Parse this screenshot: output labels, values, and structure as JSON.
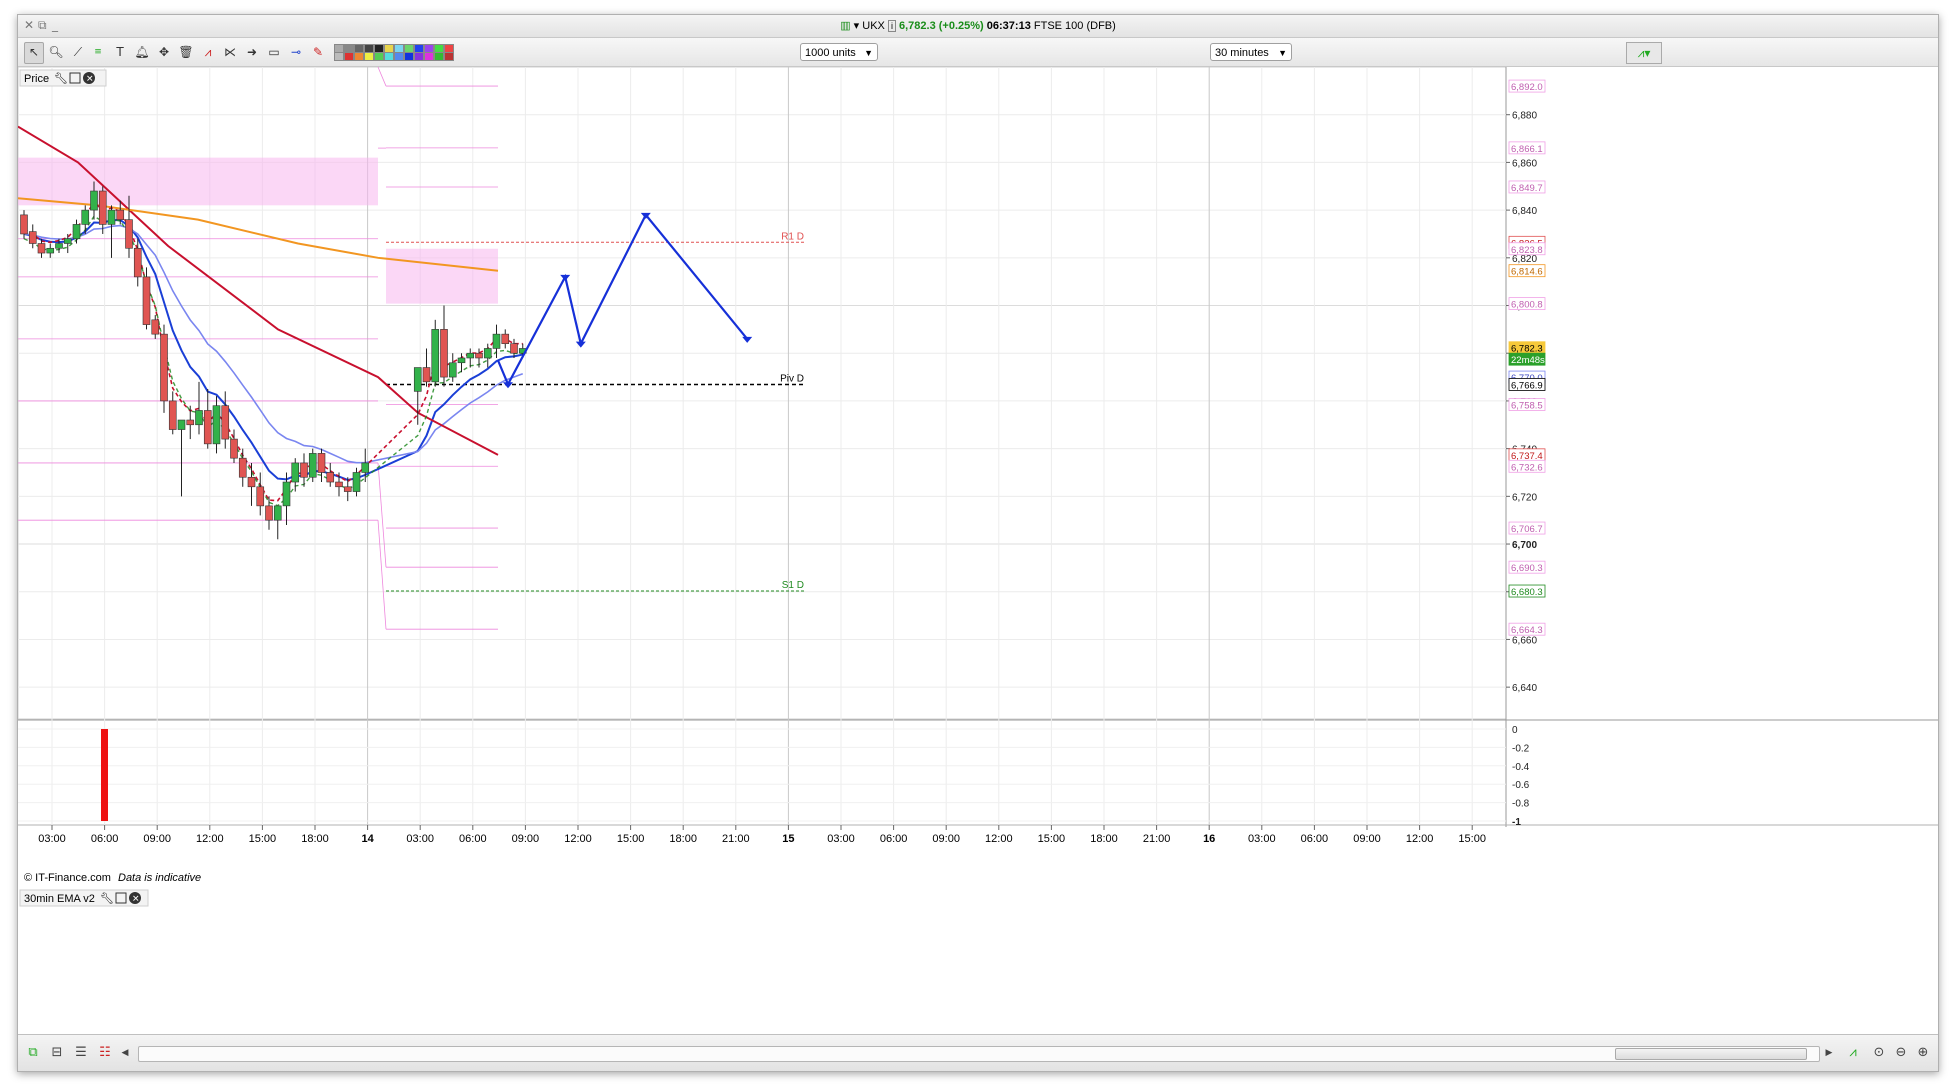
{
  "window": {
    "instrument": "UKX",
    "price": "6,782.3",
    "change": "(+0.25%)",
    "time": "06:37:13",
    "market": "FTSE 100 (DFB)"
  },
  "toolbar": {
    "units_value": "1000 units",
    "interval_value": "30 minutes",
    "tools": [
      "pointer-icon",
      "zoom-icon",
      "draw-line-icon",
      "fibonacci-icon",
      "text-tool-icon",
      "alert-bell-icon",
      "measure-icon",
      "trash-icon",
      "trend-line-icon",
      "fan-icon",
      "arrow-icon",
      "rectangle-icon",
      "horizontal-line-icon",
      "pencil-icon"
    ]
  },
  "panels": {
    "price_label": "Price",
    "indicator_label": "30min EMA v2",
    "copyright": "© IT-Finance.com",
    "disclaimer": "Data is indicative"
  },
  "colors": {
    "candle_up": "#32b24a",
    "candle_down": "#e05552",
    "ema_fast": "#1a3fd6",
    "ema_slow": "#7a86f0",
    "ema_long": "#c8102e",
    "ema_200": "#f29621",
    "signal_dashed": "#c8102e",
    "signal_dashed_green": "#1f8a1f",
    "zone": "#f7b6ee",
    "pivot_line": "#ee88dd",
    "projection": "#1630d8",
    "indicator_bar": "#ee1111"
  },
  "chart_data": {
    "type": "line",
    "ylim": [
      6630,
      6900
    ],
    "price_axis_labels": [
      "6,880",
      "6,860",
      "6,840",
      "6,820",
      "6,800",
      "6,780",
      "6,760",
      "6,740",
      "6,720",
      "6,700",
      "6,680",
      "6,660",
      "6,640"
    ],
    "time_labels": [
      "03:00",
      "06:00",
      "09:00",
      "12:00",
      "15:00",
      "18:00",
      "14",
      "03:00",
      "06:00",
      "09:00",
      "12:00",
      "15:00",
      "18:00",
      "21:00",
      "15",
      "03:00",
      "06:00",
      "09:00",
      "12:00",
      "15:00",
      "18:00",
      "21:00",
      "16",
      "03:00",
      "06:00",
      "09:00",
      "12:00",
      "15:00"
    ],
    "bold_time_labels": [
      "14",
      "15",
      "16"
    ],
    "price_tags": [
      {
        "label": "6,892.0",
        "value": 6892.0,
        "color": "#f0a0e6",
        "text": "#c060b0"
      },
      {
        "label": "6,866.1",
        "value": 6866.1,
        "color": "#f0a0e6",
        "text": "#c060b0"
      },
      {
        "label": "6,849.7",
        "value": 6849.7,
        "color": "#f0a0e6",
        "text": "#c060b0"
      },
      {
        "label": "6,826.5",
        "value": 6826.5,
        "color": "#e05050",
        "text": "#c01818"
      },
      {
        "label": "6,823.8",
        "value": 6823.8,
        "color": "#f0a0e6",
        "text": "#c060b0"
      },
      {
        "label": "6,814.6",
        "value": 6814.6,
        "color": "#f29621",
        "text": "#c06800"
      },
      {
        "label": "6,800.8",
        "value": 6800.8,
        "color": "#f0a0e6",
        "text": "#c060b0"
      },
      {
        "label": "6,782.3",
        "value": 6782.3,
        "color": "#f6c93a",
        "text": "#000000",
        "fill": "#f6c93a"
      },
      {
        "label": "22m48s",
        "value": 6777.5,
        "color": "#2aa02a",
        "text": "#ffffff",
        "fill": "#2aa02a"
      },
      {
        "label": "6,770.0",
        "value": 6770.0,
        "color": "#7a86f0",
        "text": "#3c48c0"
      },
      {
        "label": "6,766.9",
        "value": 6766.9,
        "color": "#000000",
        "text": "#000000"
      },
      {
        "label": "6,758.5",
        "value": 6758.5,
        "color": "#f0a0e6",
        "text": "#c060b0"
      },
      {
        "label": "6,737.4",
        "value": 6737.4,
        "color": "#e05050",
        "text": "#c01818"
      },
      {
        "label": "6,732.6",
        "value": 6732.6,
        "color": "#f0a0e6",
        "text": "#c060b0"
      },
      {
        "label": "6,706.7",
        "value": 6706.7,
        "color": "#f0a0e6",
        "text": "#c060b0"
      },
      {
        "label": "6,690.3",
        "value": 6690.3,
        "color": "#f0a0e6",
        "text": "#c060b0"
      },
      {
        "label": "6,680.3",
        "value": 6680.3,
        "color": "#1f8a1f",
        "text": "#1f8a1f"
      },
      {
        "label": "6,664.3",
        "value": 6664.3,
        "color": "#f0a0e6",
        "text": "#c060b0"
      }
    ],
    "bold_axis_label": "6,700",
    "pivots": [
      {
        "name": "R1 D",
        "value": 6826.5,
        "color": "#e05050"
      },
      {
        "name": "Piv D",
        "value": 6766.9,
        "color": "#000000"
      },
      {
        "name": "S1 D",
        "value": 6680.3,
        "color": "#1f8a1f"
      }
    ],
    "candles": [
      [
        6838,
        6840,
        6828,
        6830
      ],
      [
        6831,
        6834,
        6824,
        6826
      ],
      [
        6826,
        6828,
        6820,
        6822
      ],
      [
        6822,
        6826,
        6820,
        6824
      ],
      [
        6824,
        6828,
        6822,
        6826
      ],
      [
        6826,
        6830,
        6822,
        6828
      ],
      [
        6828,
        6836,
        6826,
        6834
      ],
      [
        6834,
        6842,
        6830,
        6840
      ],
      [
        6840,
        6852,
        6836,
        6848
      ],
      [
        6848,
        6850,
        6830,
        6834
      ],
      [
        6834,
        6842,
        6820,
        6840
      ],
      [
        6840,
        6844,
        6834,
        6836
      ],
      [
        6836,
        6846,
        6820,
        6824
      ],
      [
        6824,
        6828,
        6808,
        6812
      ],
      [
        6812,
        6816,
        6790,
        6792
      ],
      [
        6794,
        6796,
        6786,
        6788
      ],
      [
        6788,
        6792,
        6755,
        6760
      ],
      [
        6760,
        6764,
        6746,
        6748
      ],
      [
        6748,
        6752,
        6720,
        6752
      ],
      [
        6752,
        6758,
        6744,
        6750
      ],
      [
        6750,
        6768,
        6746,
        6756
      ],
      [
        6756,
        6765,
        6740,
        6742
      ],
      [
        6742,
        6762,
        6738,
        6758
      ],
      [
        6758,
        6764,
        6740,
        6744
      ],
      [
        6744,
        6748,
        6734,
        6736
      ],
      [
        6736,
        6740,
        6724,
        6728
      ],
      [
        6728,
        6734,
        6716,
        6724
      ],
      [
        6724,
        6730,
        6712,
        6716
      ],
      [
        6716,
        6720,
        6706,
        6710
      ],
      [
        6710,
        6716,
        6702,
        6716
      ],
      [
        6716,
        6730,
        6708,
        6726
      ],
      [
        6726,
        6736,
        6722,
        6734
      ],
      [
        6734,
        6738,
        6724,
        6728
      ],
      [
        6728,
        6740,
        6726,
        6738
      ],
      [
        6738,
        6740,
        6726,
        6730
      ],
      [
        6730,
        6734,
        6724,
        6726
      ],
      [
        6726,
        6730,
        6720,
        6724
      ],
      [
        6724,
        6728,
        6718,
        6722
      ],
      [
        6722,
        6732,
        6720,
        6730
      ],
      [
        6730,
        6740,
        6726,
        6734
      ],
      [
        6764,
        6774,
        6750,
        6774
      ],
      [
        6774,
        6782,
        6766,
        6768
      ],
      [
        6768,
        6794,
        6766,
        6790
      ],
      [
        6790,
        6800,
        6766,
        6770
      ],
      [
        6770,
        6780,
        6768,
        6776
      ],
      [
        6776,
        6780,
        6772,
        6778
      ],
      [
        6778,
        6782,
        6774,
        6780
      ],
      [
        6780,
        6782,
        6774,
        6778
      ],
      [
        6778,
        6784,
        6774,
        6782
      ],
      [
        6782,
        6792,
        6778,
        6788
      ],
      [
        6788,
        6790,
        6782,
        6784
      ],
      [
        6784,
        6786,
        6778,
        6780
      ],
      [
        6780,
        6784,
        6778,
        6782
      ]
    ],
    "projection_path": [
      [
        6766,
        6767
      ],
      [
        6810,
        6812
      ],
      [
        6822,
        6784
      ],
      [
        6872,
        6838
      ],
      [
        6950,
        6786
      ]
    ]
  }
}
